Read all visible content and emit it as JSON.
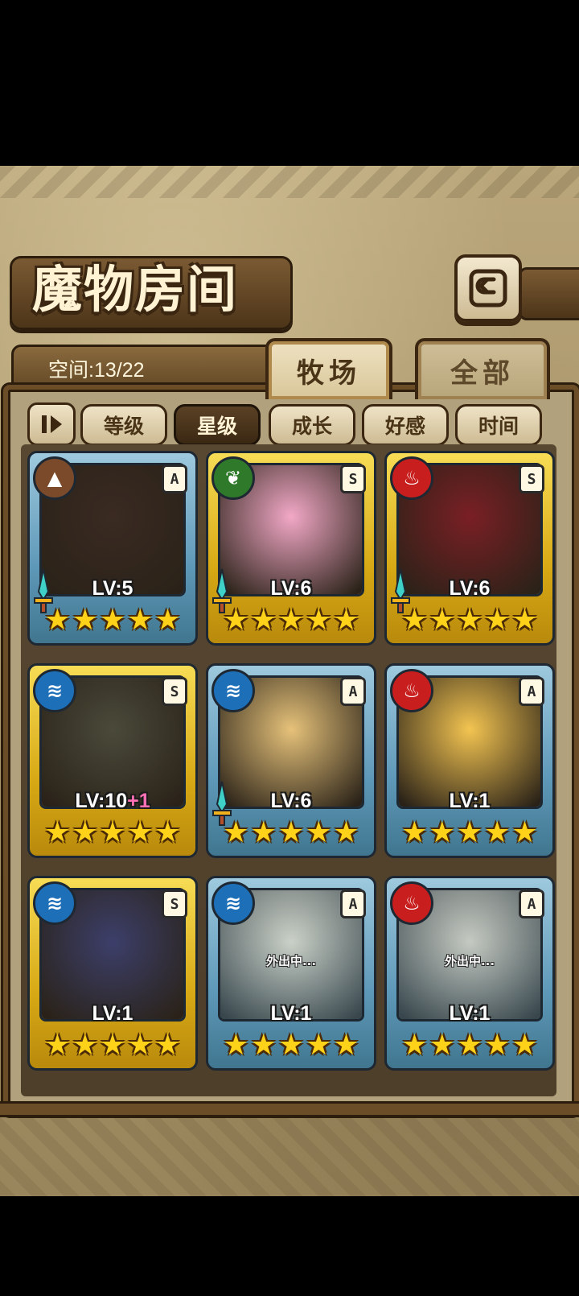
{
  "header": {
    "title": "魔物房间",
    "back_icon": "back-arrow-icon"
  },
  "capacity": {
    "text": "空间:13/22"
  },
  "tabs": [
    {
      "label": "牧场",
      "active": true
    },
    {
      "label": "全部",
      "active": false
    }
  ],
  "sort": {
    "toggle_icon": "sort-order-icon",
    "options": [
      {
        "label": "等级",
        "selected": false
      },
      {
        "label": "星级",
        "selected": true
      },
      {
        "label": "成长",
        "selected": false
      },
      {
        "label": "好感",
        "selected": false
      },
      {
        "label": "时间",
        "selected": false
      }
    ]
  },
  "colors": {
    "gold_frame": "#d7a915",
    "blue_frame": "#5e98b8",
    "star": "#ffd21a",
    "earth": "#7a4a2a",
    "plant": "#2f7a2a",
    "fire": "#c81e1e",
    "water": "#1d6fb8"
  },
  "monsters": [
    {
      "element": "earth",
      "rank": "A",
      "frame": "blue",
      "level": "LV:5",
      "bonus": "",
      "stars": 5,
      "sword": true,
      "status": "",
      "portrait": "#3a2a22"
    },
    {
      "element": "plant",
      "rank": "S",
      "frame": "gold",
      "level": "LV:6",
      "bonus": "",
      "stars": 5,
      "sword": true,
      "status": "",
      "portrait": "#f2a8c6"
    },
    {
      "element": "fire",
      "rank": "S",
      "frame": "gold",
      "level": "LV:6",
      "bonus": "",
      "stars": 5,
      "sword": true,
      "status": "",
      "portrait": "#7a1f24"
    },
    {
      "element": "water",
      "rank": "S",
      "frame": "gold",
      "level": "LV:10",
      "bonus": "+1",
      "stars": 5,
      "sword": false,
      "status": "",
      "portrait": "#4a4a3a"
    },
    {
      "element": "water",
      "rank": "A",
      "frame": "blue",
      "level": "LV:6",
      "bonus": "",
      "stars": 5,
      "sword": true,
      "status": "",
      "portrait": "#e6c27a"
    },
    {
      "element": "fire",
      "rank": "A",
      "frame": "blue",
      "level": "LV:1",
      "bonus": "",
      "stars": 5,
      "sword": false,
      "status": "",
      "portrait": "#f3c451"
    },
    {
      "element": "water",
      "rank": "S",
      "frame": "gold",
      "level": "LV:1",
      "bonus": "",
      "stars": 5,
      "sword": false,
      "status": "",
      "portrait": "#3c3f6a"
    },
    {
      "element": "water",
      "rank": "A",
      "frame": "blue",
      "level": "LV:1",
      "bonus": "",
      "stars": 5,
      "sword": false,
      "status": "外出中...",
      "portrait": "#c6b890"
    },
    {
      "element": "fire",
      "rank": "A",
      "frame": "blue",
      "level": "LV:1",
      "bonus": "",
      "stars": 5,
      "sword": false,
      "status": "外出中...",
      "portrait": "#c9ad8a"
    }
  ]
}
